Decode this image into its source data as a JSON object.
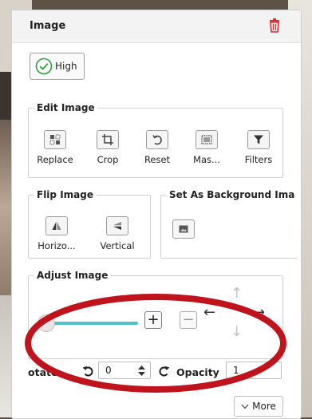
{
  "panel": {
    "title": "Image",
    "quality_label": "High"
  },
  "edit_image": {
    "legend": "Edit Image",
    "tools": [
      {
        "label": "Replace",
        "icon": "replace-icon"
      },
      {
        "label": "Crop",
        "icon": "crop-icon"
      },
      {
        "label": "Reset",
        "icon": "reset-icon"
      },
      {
        "label": "Mas...",
        "icon": "mask-icon"
      },
      {
        "label": "Filters",
        "icon": "filter-icon"
      }
    ]
  },
  "flip_image": {
    "legend": "Flip Image",
    "tools": [
      {
        "label": "Horizo...",
        "icon": "flip-horizontal-icon"
      },
      {
        "label": "Vertical",
        "icon": "flip-vertical-icon"
      }
    ]
  },
  "background": {
    "legend": "Set As Background Ima"
  },
  "adjust_image": {
    "legend": "Adjust Image",
    "zoom_in": "+",
    "zoom_out": "−",
    "slider_value_fraction": 0.0
  },
  "rotate": {
    "label": "otate",
    "value": "0"
  },
  "opacity": {
    "label": "Opacity",
    "value": "1"
  },
  "more": {
    "label": "More"
  },
  "colors": {
    "accent": "#4fc0d0",
    "trash": "#d32f2f",
    "check": "#2e9e3e",
    "annotation": "#c0141c"
  }
}
